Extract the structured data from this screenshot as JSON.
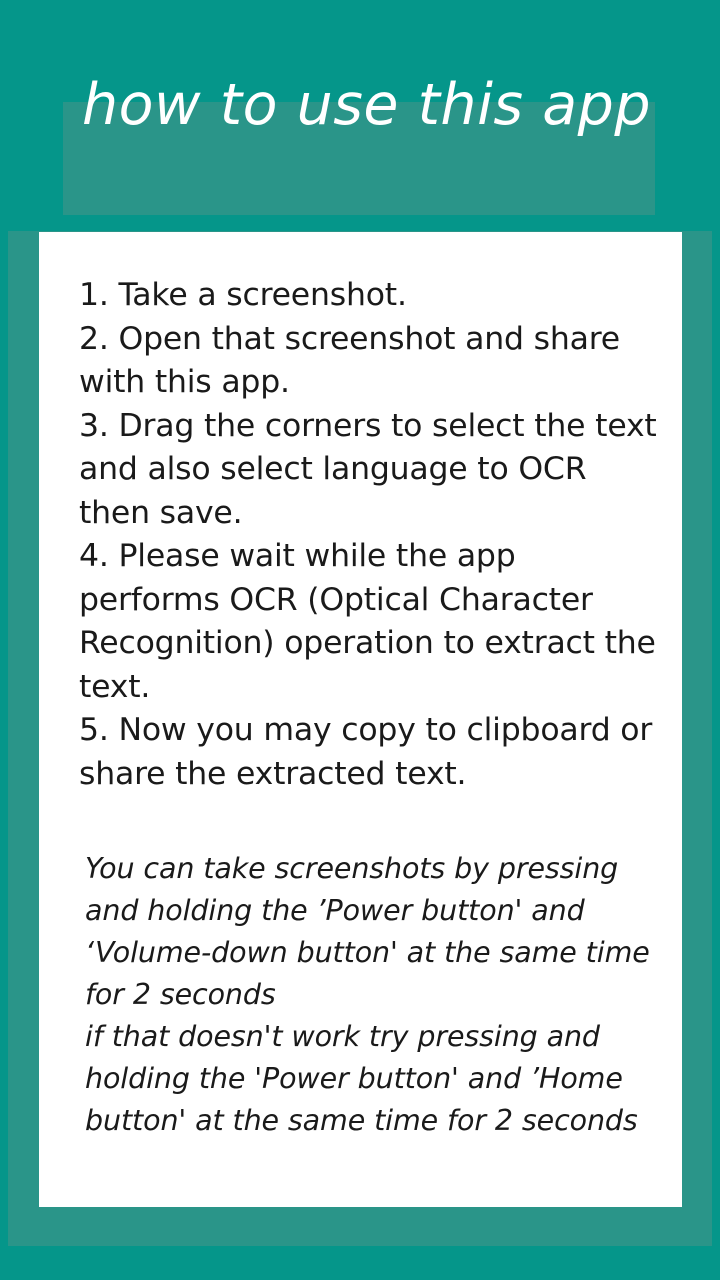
{
  "app": {
    "title": "how to use this app",
    "background_color": "#05968a",
    "panel_color": "#2a9589",
    "card_color": "#ffffff",
    "title_text_color": "#ffffff",
    "body_text_color": "#1a1a1a"
  },
  "instructions": {
    "steps": [
      {
        "number": "1.",
        "text": "Take a screenshot."
      },
      {
        "number": "2.",
        "text": "Open that screenshot and share with this app."
      },
      {
        "number": "3.",
        "text": "Drag the corners to select the text and also select language to OCR then save."
      },
      {
        "number": "4.",
        "text": "Please wait while the app performs OCR (Optical Character Recognition) operation to extract the text."
      },
      {
        "number": "5.",
        "text": "Now you may copy to clipboard or share the extracted text."
      }
    ],
    "full_lines": [
      "1. Take a screenshot.",
      "2.  Open that screenshot and share",
      "with this app.",
      "3.  Drag the corners to select the",
      "text and also select language to",
      "OCR then save.",
      "4.  Please wait while the app",
      "performs OCR (Optical Character",
      "Recognition) operation to extract",
      "the text.",
      "5.  Now you may copy to clipboard",
      "or share the extracted text."
    ]
  },
  "note": {
    "paragraphs": [
      "You can take screenshots by pressing and holding the ’Power button' and ‘Volume-down button' at the same time for 2 seconds",
      "if that doesn't work try pressing and holding the 'Power button' and ’Home button' at the same time for 2 seconds"
    ]
  }
}
